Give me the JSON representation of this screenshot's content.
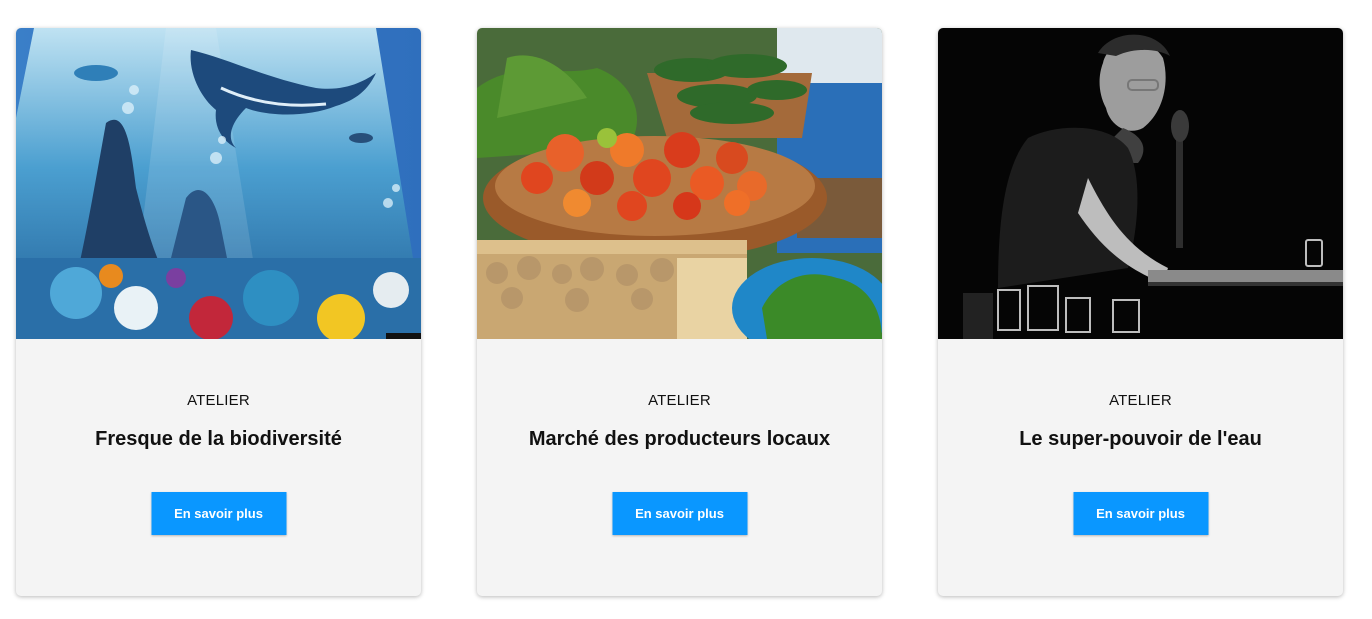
{
  "cards": [
    {
      "category": "ATELIER",
      "title": "Fresque de la biodiversité",
      "button_label": "En savoir plus",
      "image_alt": "underwater-mural-image"
    },
    {
      "category": "ATELIER",
      "title": "Marché des producteurs locaux",
      "button_label": "En savoir plus",
      "image_alt": "vegetable-market-image"
    },
    {
      "category": "ATELIER",
      "title": "Le super-pouvoir de l'eau",
      "button_label": "En savoir plus",
      "image_alt": "speaker-portrait-image"
    }
  ],
  "colors": {
    "card_background": "#f4f4f4",
    "button_background": "#0a97ff",
    "button_text": "#ffffff",
    "text": "#111111"
  }
}
